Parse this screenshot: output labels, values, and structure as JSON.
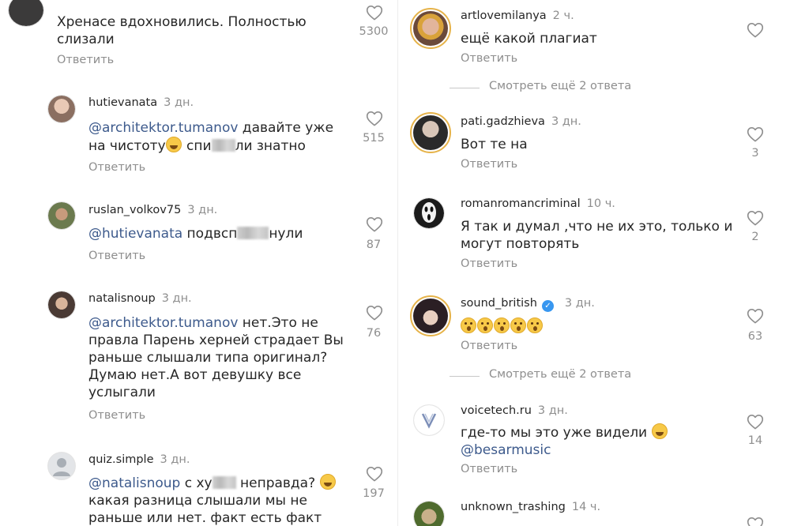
{
  "reply_label": "Ответить",
  "left": [
    {
      "id": "c0",
      "username": "",
      "time": "",
      "lines": [
        "Хренасе вдохновились. Полностью",
        "слизали"
      ],
      "likes": "5300"
    },
    {
      "id": "c1",
      "username": "hutievanata",
      "time": "3 дн.",
      "mention": "@architektor.tumanov",
      "text_a": " давайте уже",
      "line2_a": "на чистоту",
      "line2_b": " спи",
      "line2_c": "ли знатно",
      "likes": "515"
    },
    {
      "id": "c2",
      "username": "ruslan_volkov75",
      "time": "3 дн.",
      "mention": "@hutievanata",
      "text_a": " подвсп",
      "text_b": "нули",
      "likes": "87"
    },
    {
      "id": "c3",
      "username": "natalisnoup",
      "time": "3 дн.",
      "mention": "@architektor.tumanov",
      "text_a": " нет.Это не",
      "lines": [
        "правла Парень херней страдает Вы",
        "раньше слышали типа оригинал?",
        "Думаю нет.А вот девушку все",
        "услыгали"
      ],
      "likes": "76"
    },
    {
      "id": "c4",
      "username": "quiz.simple",
      "time": "3 дн.",
      "mention": "@natalisnoup",
      "text_a": " с ху",
      "text_b": " неправда?",
      "lines": [
        "какая разница слышали мы не",
        "раньше или нет. факт есть факт"
      ],
      "likes": "197"
    }
  ],
  "right": [
    {
      "id": "r0",
      "username": "artlovemilanya",
      "time": "2 ч.",
      "text": "ещё какой плагиат",
      "likes": ""
    },
    {
      "id": "r1",
      "username": "pati.gadzhieva",
      "time": "3 дн.",
      "text": "Вот те на",
      "likes": "3"
    },
    {
      "id": "r2",
      "username": "romanromancriminal",
      "time": "10 ч.",
      "lines": [
        "Я так и думал ,что не их это, только и",
        "могут повторять"
      ],
      "likes": "2"
    },
    {
      "id": "r3",
      "username": "sound_british",
      "time": "3 дн.",
      "likes": "63"
    },
    {
      "id": "r4",
      "username": "voicetech.ru",
      "time": "3 дн.",
      "text": "где-то мы это уже видели",
      "mention": "@besarmusic",
      "likes": "14"
    },
    {
      "id": "r5",
      "username": "unknown_trashing",
      "time": "14 ч."
    }
  ],
  "more_replies": "Смотреть ещё 2 ответа",
  "colors": {
    "mention": "#3d5a8c",
    "secondary": "#8e8e8e",
    "story_ring": "#e6b34a",
    "verified": "#3897f0"
  }
}
